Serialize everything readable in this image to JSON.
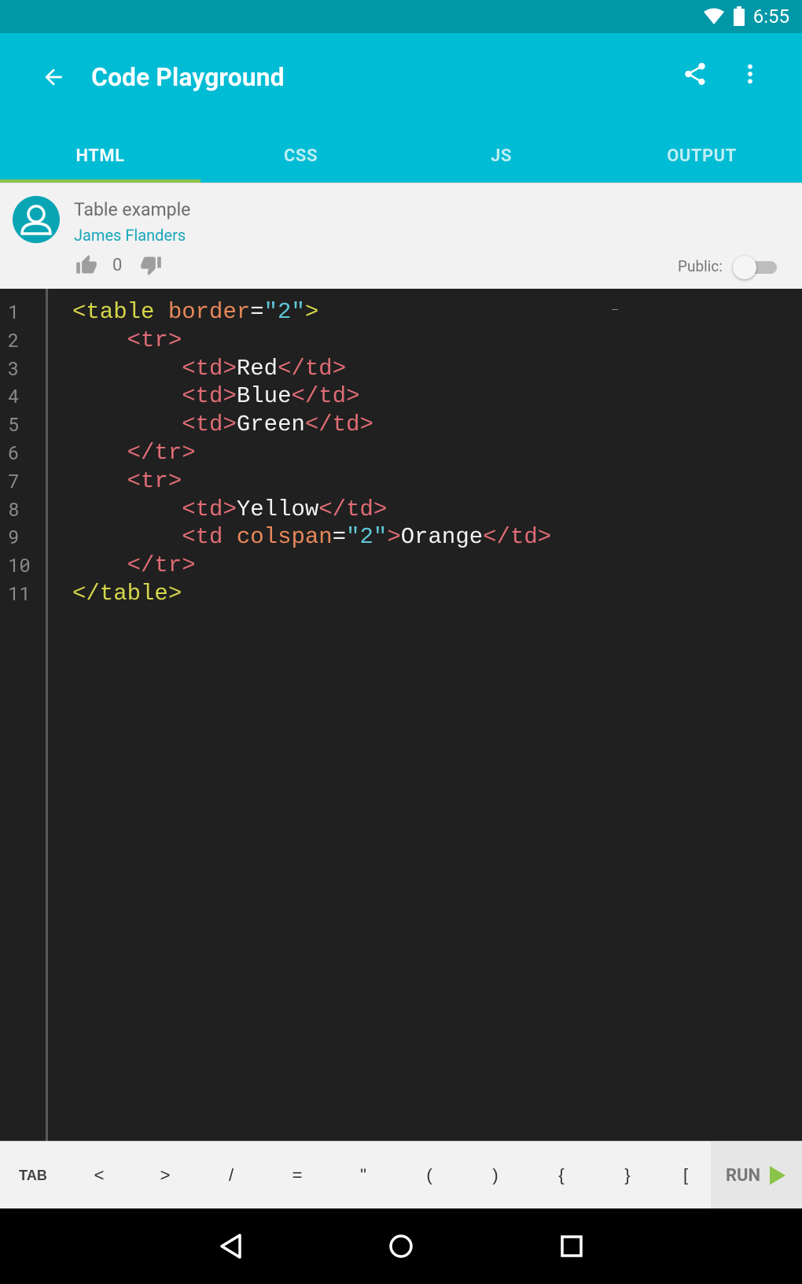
{
  "status_bar": {
    "time": "6:55"
  },
  "app_bar": {
    "title": "Code Playground"
  },
  "tabs": [
    {
      "label": "HTML",
      "active": true
    },
    {
      "label": "CSS",
      "active": false
    },
    {
      "label": "JS",
      "active": false
    },
    {
      "label": "OUTPUT",
      "active": false
    }
  ],
  "info": {
    "code_title": "Table example",
    "author": "James Flanders",
    "votes": "0",
    "public_label": "Public:",
    "public_enabled": false
  },
  "editor": {
    "line_numbers": [
      "1",
      "2",
      "3",
      "4",
      "5",
      "6",
      "7",
      "8",
      "9",
      "10",
      "11"
    ],
    "lines": [
      "<table border=\"2\">",
      "    <tr>",
      "        <td>Red</td>",
      "        <td>Blue</td>",
      "        <td>Green</td>",
      "    </tr>",
      "    <tr>",
      "        <td>Yellow</td>",
      "        <td colspan=\"2\">Orange</td>",
      "    </tr>",
      "</table>"
    ]
  },
  "key_bar": {
    "keys": [
      "TAB",
      "<",
      ">",
      "/",
      "=",
      "\"",
      "(",
      ")",
      "{",
      "}",
      "["
    ],
    "run_label": "RUN"
  },
  "colors": {
    "app_bar": "#00bcd4",
    "status_bar": "#0097a7",
    "tab_indicator": "#8bc34a",
    "editor_bg": "#202020",
    "tag": "#e06c75",
    "attribute": "#e8885a",
    "string": "#5fc7d6",
    "table_tag": "#d6d64a",
    "run_icon": "#8bc34a"
  },
  "icons": {
    "status": [
      "wifi-icon",
      "battery-icon"
    ],
    "app_bar": [
      "back-arrow-icon",
      "share-icon",
      "more-vert-icon"
    ],
    "info": [
      "avatar-icon",
      "thumb-up-icon",
      "thumb-down-icon"
    ],
    "run": "play-icon",
    "nav": [
      "nav-back-icon",
      "nav-home-icon",
      "nav-recents-icon"
    ]
  }
}
